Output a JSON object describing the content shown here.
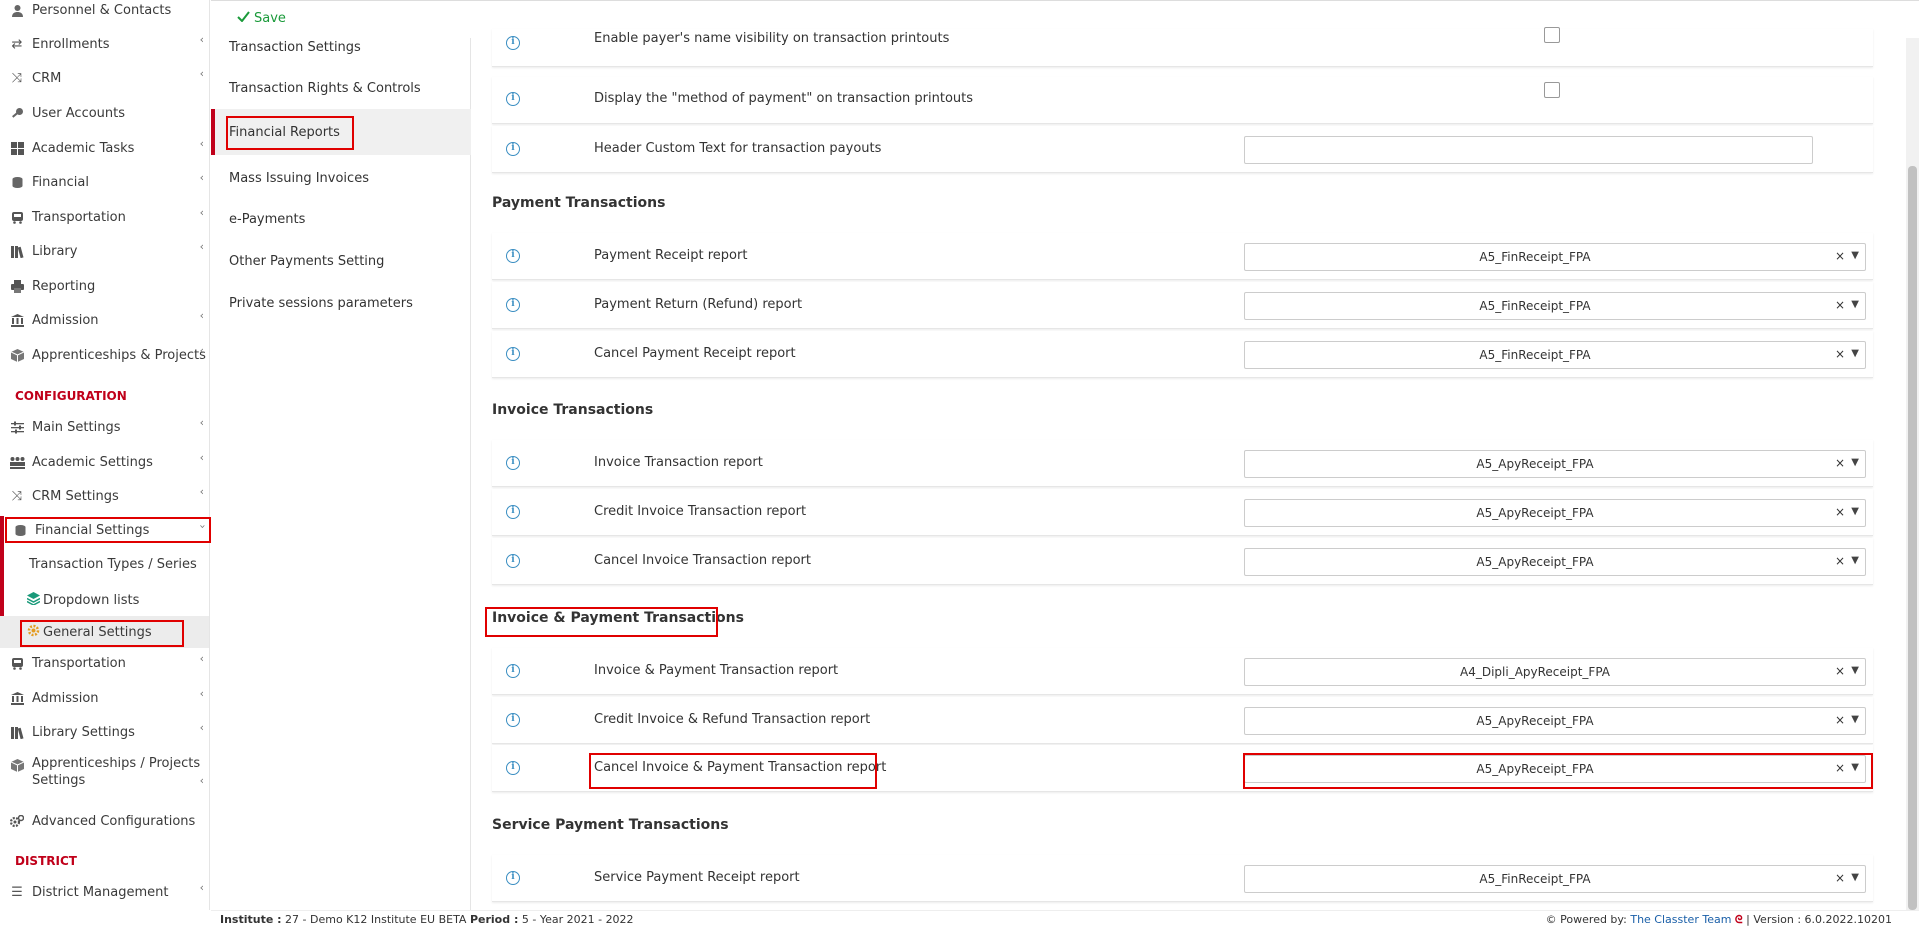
{
  "toolbar": {
    "save_label": "Save"
  },
  "sidebar": {
    "items": [
      {
        "label": "Personnel & Contacts",
        "icon": "person-icon",
        "chevron": false
      },
      {
        "label": "Enrollments",
        "icon": "arrows-exchange-icon",
        "chevron": true
      },
      {
        "label": "CRM",
        "icon": "shuffle-icon",
        "chevron": true
      },
      {
        "label": "User Accounts",
        "icon": "key-icon",
        "chevron": false
      },
      {
        "label": "Academic Tasks",
        "icon": "grid-icon",
        "chevron": true
      },
      {
        "label": "Financial",
        "icon": "coins-icon",
        "chevron": true
      },
      {
        "label": "Transportation",
        "icon": "bus-icon",
        "chevron": true
      },
      {
        "label": "Library",
        "icon": "books-icon",
        "chevron": true
      },
      {
        "label": "Reporting",
        "icon": "printer-icon",
        "chevron": false
      },
      {
        "label": "Admission",
        "icon": "institution-icon",
        "chevron": true
      },
      {
        "label": "Apprenticeships & Projects",
        "icon": "cube-icon",
        "chevron": true
      }
    ],
    "config_heading": "CONFIGURATION",
    "config_items": [
      {
        "label": "Main Settings",
        "icon": "sliders-icon",
        "chevron": true
      },
      {
        "label": "Academic Settings",
        "icon": "people-icon",
        "chevron": true
      },
      {
        "label": "CRM Settings",
        "icon": "shuffle-icon",
        "chevron": true
      },
      {
        "label": "Financial Settings",
        "icon": "coins-icon",
        "chevron": true
      }
    ],
    "financial_sub": [
      {
        "label": "Transaction Types / Series"
      },
      {
        "label": "Dropdown lists",
        "icon": "layers-icon"
      },
      {
        "label": "General Settings",
        "icon": "cogs-icon"
      }
    ],
    "config_items_2": [
      {
        "label": "Transportation",
        "icon": "bus-icon",
        "chevron": true
      },
      {
        "label": "Admission",
        "icon": "institution-icon",
        "chevron": true
      },
      {
        "label": "Library Settings",
        "icon": "books-icon",
        "chevron": true
      },
      {
        "label": "Apprenticeships / Projects Settings",
        "icon": "cube-icon",
        "chevron": true
      },
      {
        "label": "Advanced Configurations",
        "icon": "cogs-icon",
        "chevron": false
      }
    ],
    "district_heading": "DISTRICT",
    "district_items": [
      {
        "label": "District Management",
        "icon": "list-icon",
        "chevron": true
      }
    ]
  },
  "submenu": {
    "items": [
      {
        "label": "Transaction Settings"
      },
      {
        "label": "Transaction Rights & Controls"
      },
      {
        "label": "Financial Reports",
        "active": true
      },
      {
        "label": "Mass Issuing Invoices"
      },
      {
        "label": "e-Payments"
      },
      {
        "label": "Other Payments Setting"
      },
      {
        "label": "Private sessions parameters"
      }
    ]
  },
  "content": {
    "top_rows": [
      {
        "label": "Enable payer's name visibility on transaction printouts",
        "control": "checkbox"
      },
      {
        "label": "Display the \"method of payment\" on transaction printouts",
        "control": "checkbox"
      },
      {
        "label": "Header Custom Text for transaction payouts",
        "control": "text",
        "value": ""
      }
    ],
    "sections": [
      {
        "title": "Payment Transactions",
        "rows": [
          {
            "label": "Payment Receipt report",
            "value": "A5_FinReceipt_FPA"
          },
          {
            "label": "Payment Return (Refund) report",
            "value": "A5_FinReceipt_FPA"
          },
          {
            "label": "Cancel Payment Receipt report",
            "value": "A5_FinReceipt_FPA"
          }
        ]
      },
      {
        "title": "Invoice Transactions",
        "rows": [
          {
            "label": "Invoice Transaction report",
            "value": "A5_ApyReceipt_FPA"
          },
          {
            "label": "Credit Invoice Transaction report",
            "value": "A5_ApyReceipt_FPA"
          },
          {
            "label": "Cancel Invoice Transaction report",
            "value": "A5_ApyReceipt_FPA"
          }
        ]
      },
      {
        "title": "Invoice & Payment Transactions",
        "rows": [
          {
            "label": "Invoice & Payment Transaction report",
            "value": "A4_Dipli_ApyReceipt_FPA"
          },
          {
            "label": "Credit Invoice & Refund Transaction report",
            "value": "A5_ApyReceipt_FPA"
          },
          {
            "label": "Cancel Invoice & Payment Transaction report",
            "value": "A5_ApyReceipt_FPA"
          }
        ]
      },
      {
        "title": "Service Payment Transactions",
        "rows": [
          {
            "label": "Service Payment Receipt report",
            "value": "A5_FinReceipt_FPA"
          }
        ]
      }
    ]
  },
  "footer": {
    "institute_label": "Institute :",
    "institute_value": "27 - Demo K12 Institute EU BETA",
    "period_label": "Period :",
    "period_value": "5 - Year 2021 - 2022",
    "powered_by": "Powered by:",
    "team": "The Classter Team",
    "version": "| Version : 6.0.2022.10201"
  },
  "colors": {
    "accent": "#c0001a",
    "save": "#1a9a3a",
    "info": "#3a8ec2",
    "highlight": "#e00000"
  }
}
